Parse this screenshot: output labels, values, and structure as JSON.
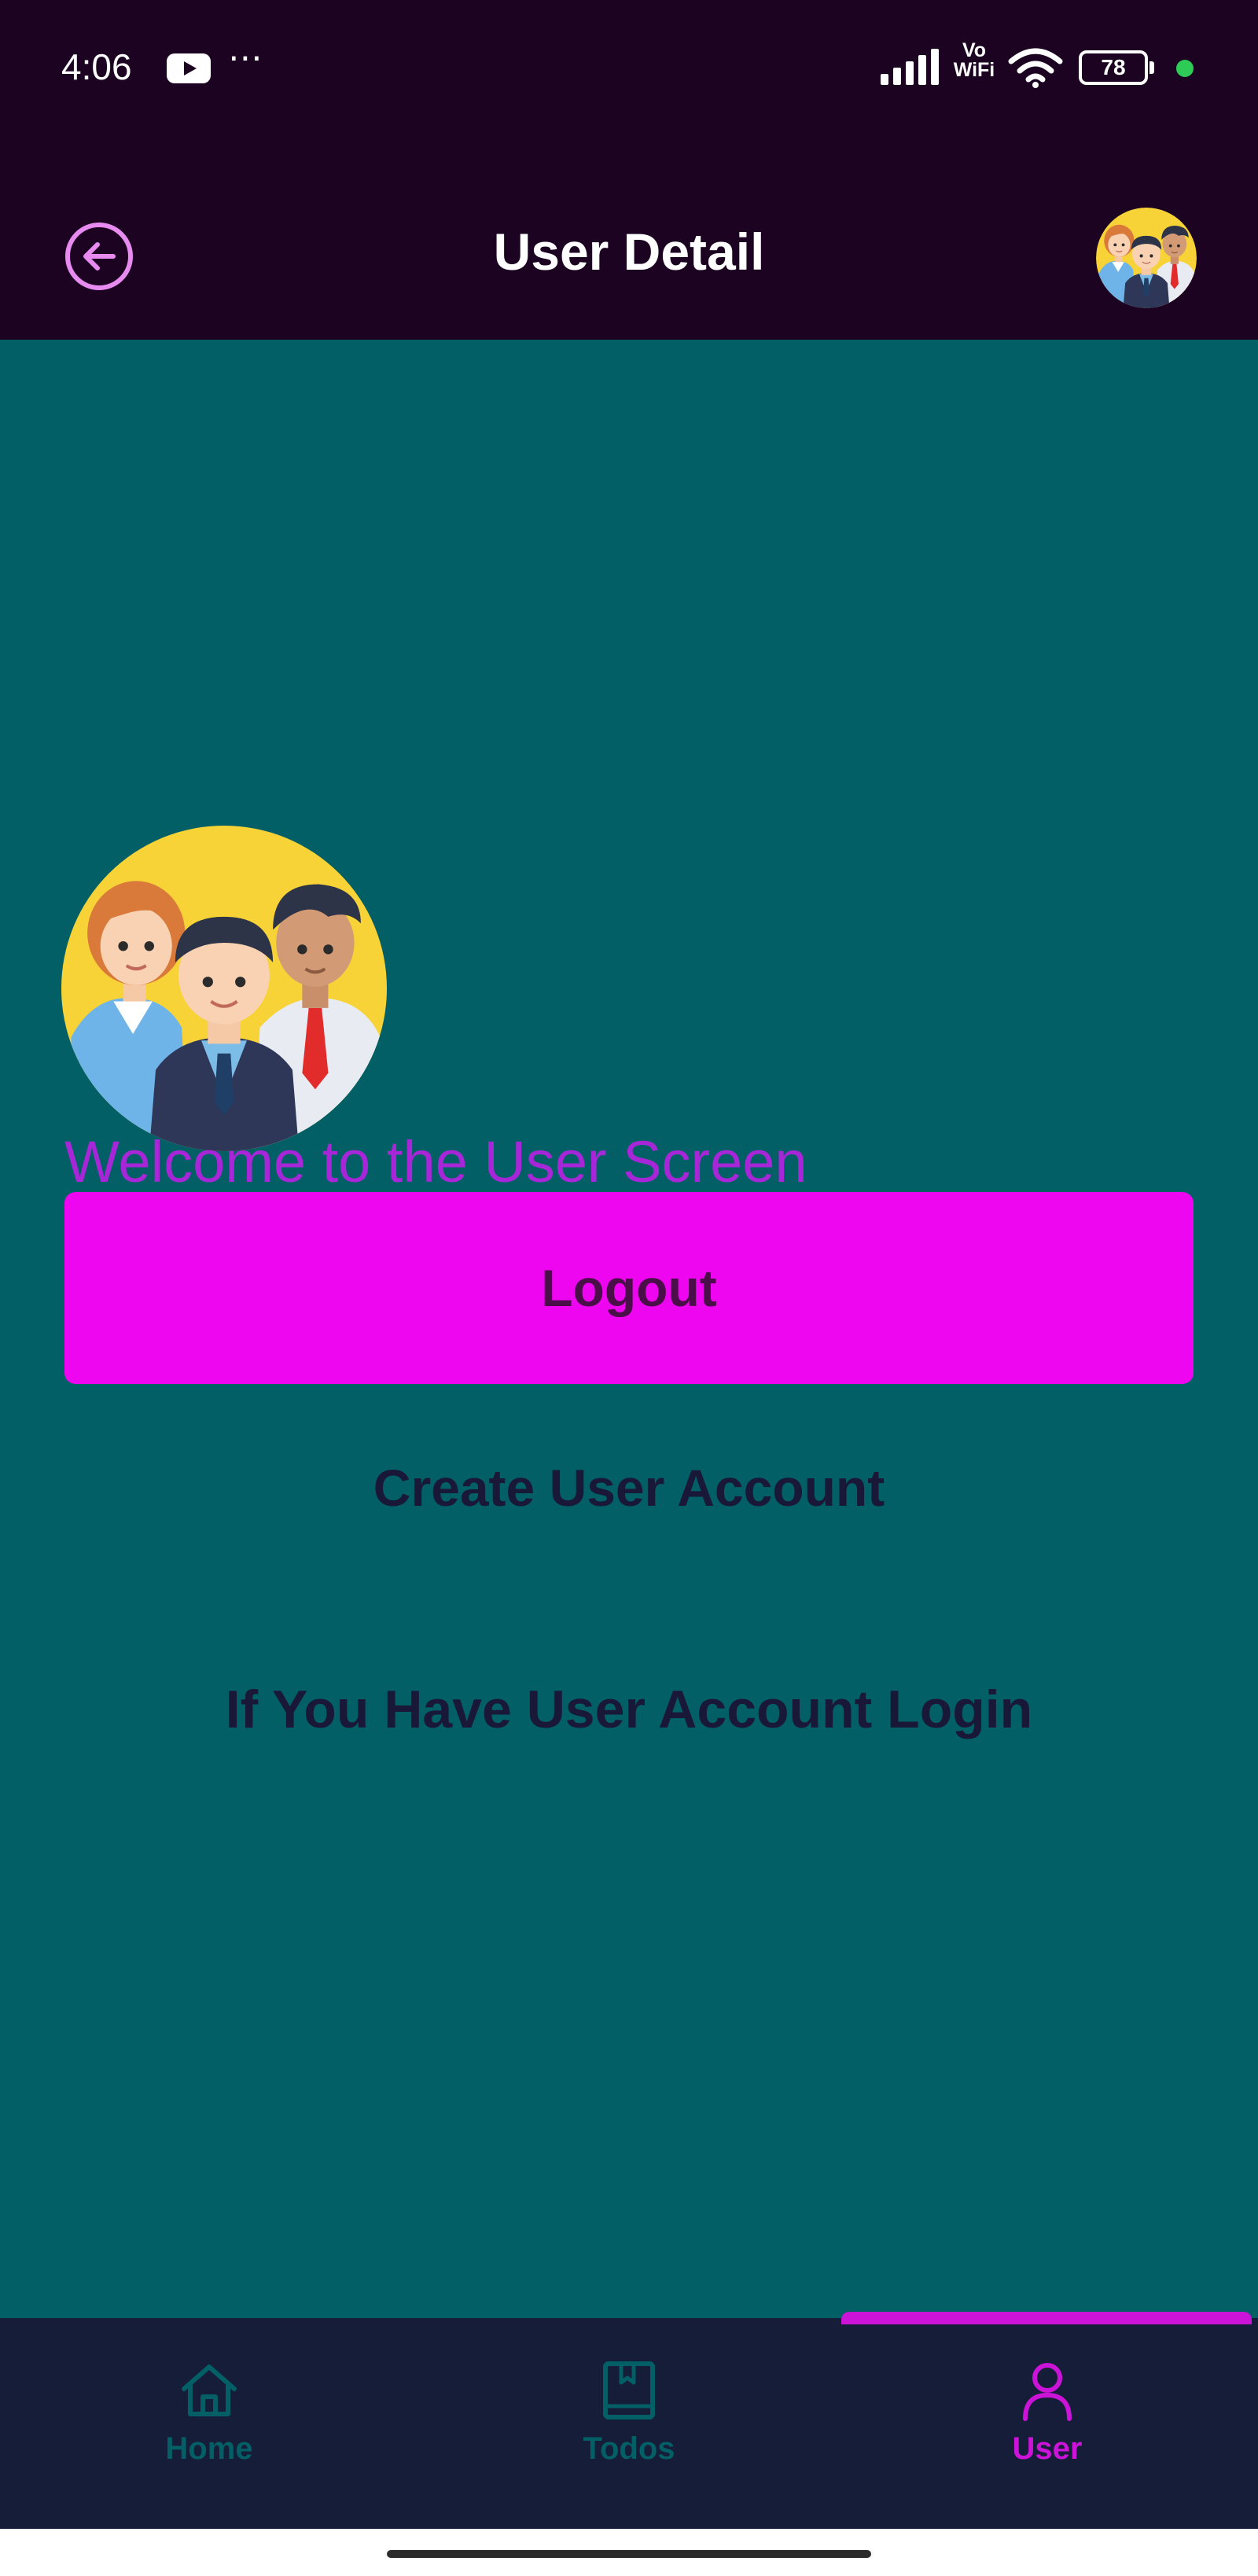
{
  "status_bar": {
    "time": "4:06",
    "network_label": "Vo WiFi",
    "battery_level": "78",
    "notification_icons": [
      "youtube-icon",
      "more-icon"
    ],
    "system_icons": [
      "signal-icon",
      "vowifi-icon",
      "wifi-icon",
      "battery-icon",
      "privacy-dot-icon"
    ]
  },
  "app_bar": {
    "title": "User Detail",
    "back_icon": "back-arrow-icon",
    "avatar_icon": "users-group-icon"
  },
  "main": {
    "illustration_icon": "users-group-icon",
    "welcome_text": "Welcome to the User Screen",
    "logout_label": "Logout",
    "create_account_label": "Create User Account",
    "login_link_label": "If You Have User Account Login"
  },
  "bottom_nav": {
    "items": [
      {
        "label": "Home",
        "icon": "home-icon",
        "active": false
      },
      {
        "label": "Todos",
        "icon": "book-icon",
        "active": false
      },
      {
        "label": "User",
        "icon": "person-icon",
        "active": true
      }
    ]
  },
  "colors": {
    "top_bar": "#1c0322",
    "background": "#035f66",
    "accent": "#ef06f0",
    "welcome_text": "#a626d8",
    "dark_text": "#1a1838",
    "nav_background": "#161d38",
    "nav_active": "#cc13d8"
  }
}
